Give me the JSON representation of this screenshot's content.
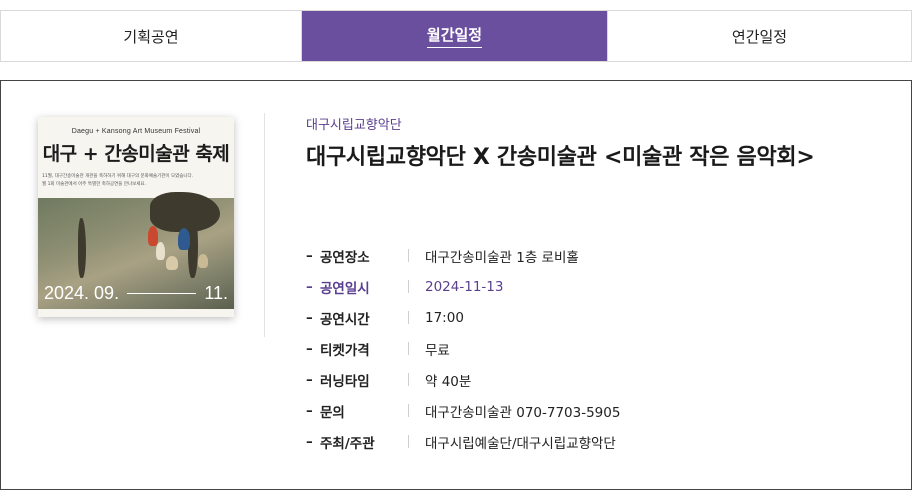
{
  "tabs": [
    {
      "label": "기획공연",
      "active": false
    },
    {
      "label": "월간일정",
      "active": true
    },
    {
      "label": "연간일정",
      "active": false
    }
  ],
  "poster": {
    "english_title": "Daegu + Kansong Art Museum Festival",
    "title": "대구 + 간송미술관 축제",
    "description_line1": "11월, 대구간송미술관 개관을 축하하기 위해 대구의 문화예술기관이 모였습니다.",
    "description_line2": "월 1회 미술관에서 아주 특별한 축하공연을 만나보세요.",
    "date_start": "2024. 09.",
    "date_end": "11."
  },
  "event": {
    "organization": "대구시립교향악단",
    "title": "대구시립교향악단 X 간송미술관 <미술관 작은 음악회>"
  },
  "details": [
    {
      "label": "공연장소",
      "value": "대구간송미술관 1층 로비홀",
      "highlight": false
    },
    {
      "label": "공연일시",
      "value": "2024-11-13",
      "highlight": true
    },
    {
      "label": "공연시간",
      "value": "17:00",
      "highlight": false
    },
    {
      "label": "티켓가격",
      "value": "무료",
      "highlight": false
    },
    {
      "label": "러닝타임",
      "value": "약 40분",
      "highlight": false
    },
    {
      "label": "문의",
      "value": "대구간송미술관 070-7703-5905",
      "highlight": false
    },
    {
      "label": "주최/주관",
      "value": "대구시립예술단/대구시립교향악단",
      "highlight": false
    }
  ],
  "colors": {
    "accent": "#6b4f9f",
    "highlight_text": "#5a3f8f"
  }
}
